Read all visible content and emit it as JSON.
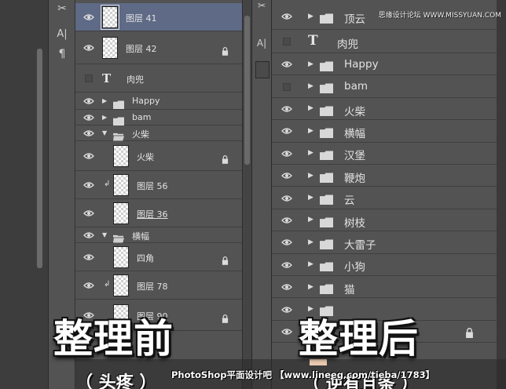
{
  "watermark": "思缘设计论坛 WWW.MISSYUAN.COM",
  "left_panel": {
    "tool_glyphs": [
      "✂",
      "A|",
      "¶"
    ],
    "layers": [
      {
        "kind": "image",
        "label": "图层 41",
        "visible": true,
        "selected": true,
        "locked": false
      },
      {
        "kind": "image",
        "label": "图层 42",
        "visible": true,
        "locked": true
      },
      {
        "kind": "text",
        "glyph": "T",
        "label": "肉兜",
        "visible": false
      },
      {
        "kind": "folder",
        "label": "Happy",
        "visible": true,
        "expanded": false
      },
      {
        "kind": "folder",
        "label": "bam",
        "visible": true,
        "expanded": false
      },
      {
        "kind": "folder",
        "label": "火柴",
        "visible": true,
        "expanded": true
      },
      {
        "kind": "image",
        "label": "火柴",
        "visible": true,
        "locked": true,
        "indent": 1
      },
      {
        "kind": "image",
        "label": "图层 56",
        "visible": true,
        "clipped": true,
        "indent": 1
      },
      {
        "kind": "image",
        "label": "图层 36",
        "visible": true,
        "underline": true,
        "indent": 1
      },
      {
        "kind": "folder",
        "label": "横幅",
        "visible": true,
        "expanded": true
      },
      {
        "kind": "image",
        "label": "四角",
        "visible": true,
        "locked": true,
        "indent": 1
      },
      {
        "kind": "image",
        "label": "图层 78",
        "visible": true,
        "clipped": true,
        "indent": 1
      },
      {
        "kind": "image",
        "label": "图层 90",
        "visible": true,
        "locked": true,
        "indent": 1
      }
    ]
  },
  "right_panel": {
    "layers": [
      {
        "kind": "folder",
        "label": "顶云",
        "visible": true
      },
      {
        "kind": "text",
        "glyph": "T",
        "label": "肉兜",
        "visible": false
      },
      {
        "kind": "folder",
        "label": "Happy",
        "visible": true
      },
      {
        "kind": "folder",
        "label": "bam",
        "visible": false
      },
      {
        "kind": "folder",
        "label": "火柴",
        "visible": true
      },
      {
        "kind": "folder",
        "label": "横幅",
        "visible": true
      },
      {
        "kind": "folder",
        "label": "汉堡",
        "visible": true
      },
      {
        "kind": "folder",
        "label": "鞭炮",
        "visible": true
      },
      {
        "kind": "folder",
        "label": "云",
        "visible": true
      },
      {
        "kind": "folder",
        "label": "树枝",
        "visible": true
      },
      {
        "kind": "folder",
        "label": "大雷子",
        "visible": true
      },
      {
        "kind": "folder",
        "label": "小狗",
        "visible": true
      },
      {
        "kind": "folder",
        "label": "猫",
        "visible": true
      },
      {
        "kind": "folder",
        "label": "",
        "visible": true
      },
      {
        "kind": "image",
        "label": "",
        "visible": true,
        "locked": true
      }
    ]
  },
  "overlay": {
    "before_title": "整理前",
    "after_title": "整理后",
    "before_sub": "（ 头疼 ）",
    "after_sub": "（ 逆有且条 ）",
    "credit": "PhotoShop平面设计吧  【www.lineeg.com/tieba/1783】"
  },
  "colors": {
    "panel_bg": "#535353",
    "selected_row": "#5e6a86",
    "row_border": "#3f3f3f",
    "overlay_text": "#ffffff"
  }
}
